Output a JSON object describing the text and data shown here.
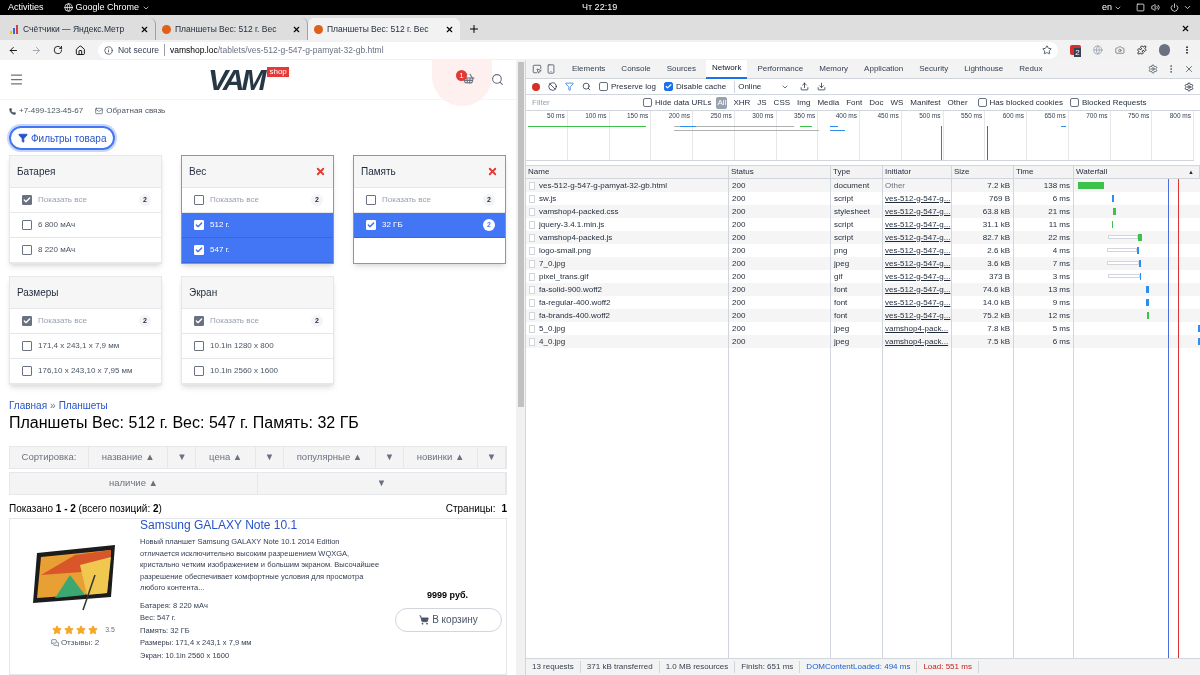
{
  "system_bar": {
    "activities": "Activities",
    "app": "Google Chrome",
    "clock": "Чт 22:19",
    "language": "en"
  },
  "browser": {
    "tabs": [
      {
        "title": "Счётчики — Яндекс.Метр",
        "selected": false,
        "kind": "metrika"
      },
      {
        "title": "Планшеты Вес: 512 г. Вес",
        "selected": false,
        "kind": "site"
      },
      {
        "title": "Планшеты Вес: 512 г. Вес",
        "selected": true,
        "kind": "site"
      }
    ],
    "security": "Not secure",
    "url_host": "vamshop.loc",
    "url_path": "/tablets/ves-512-g-547-g-pamyat-32-gb.html",
    "extension_badge": "2"
  },
  "site": {
    "logo": "VAM",
    "logo_tag": "shop",
    "cart_count": "1",
    "phone": "+7-499-123-45-67",
    "feedback": "Обратная связь",
    "filters_button": "Фильтры товара",
    "filters": [
      {
        "title": "Батарея",
        "active": false,
        "options": [
          {
            "label": "Показать все",
            "count": "2",
            "kind": "all",
            "checked": true,
            "selected": false
          },
          {
            "label": "6 800 мАч",
            "kind": "value",
            "checked": false,
            "selected": false
          },
          {
            "label": "8 220 мАч",
            "kind": "value",
            "checked": false,
            "selected": false
          }
        ]
      },
      {
        "title": "Вес",
        "active": true,
        "options": [
          {
            "label": "Показать все",
            "count": "2",
            "kind": "all",
            "checked": false,
            "selected": false
          },
          {
            "label": "512 г.",
            "kind": "value",
            "checked": true,
            "selected": true
          },
          {
            "label": "547 г.",
            "kind": "value",
            "checked": true,
            "selected": true
          }
        ]
      },
      {
        "title": "Память",
        "active": true,
        "options": [
          {
            "label": "Показать все",
            "count": "2",
            "kind": "all",
            "checked": false,
            "selected": false
          },
          {
            "label": "32 ГБ",
            "count": "2",
            "kind": "value",
            "checked": true,
            "selected": true
          }
        ]
      },
      {
        "title": "Размеры",
        "active": false,
        "options": [
          {
            "label": "Показать все",
            "count": "2",
            "kind": "all",
            "checked": true,
            "selected": false
          },
          {
            "label": "171,4 x 243,1 x 7,9 мм",
            "kind": "value",
            "checked": false,
            "selected": false
          },
          {
            "label": "176,10 x 243,10 x 7,95 мм",
            "kind": "value",
            "checked": false,
            "selected": false
          }
        ]
      },
      {
        "title": "Экран",
        "active": false,
        "options": [
          {
            "label": "Показать все",
            "count": "2",
            "kind": "all",
            "checked": true,
            "selected": false
          },
          {
            "label": "10.1in 1280 x 800",
            "kind": "value",
            "checked": false,
            "selected": false
          },
          {
            "label": "10.1in 2560 x 1600",
            "kind": "value",
            "checked": false,
            "selected": false
          }
        ]
      }
    ],
    "breadcrumbs": [
      "Главная",
      "Планшеты"
    ],
    "breadcrumb_separator": "»",
    "heading": "Планшеты Вес: 512 г. Вес: 547 г. Память: 32 ГБ",
    "sort": {
      "label": "Сортировка:",
      "rows": [
        {
          "options": [
            {
              "asc": "название ▲",
              "desc": "▼"
            },
            {
              "asc": "цена ▲",
              "desc": "▼"
            },
            {
              "asc": "популярные ▲",
              "desc": "▼"
            },
            {
              "asc": "новинки ▲",
              "desc": "▼"
            }
          ]
        },
        {
          "options": [
            {
              "asc": "наличие ▲",
              "desc": "▼"
            }
          ]
        }
      ]
    },
    "shown": "Показано **1 - 2** (всего позиций: **2**)",
    "pages_label": "Страницы:",
    "page": "1",
    "products": [
      {
        "title": "Samsung GALAXY Note 10.1",
        "description": "Новый планшет Samsung GALAXY Note 10.1 2014 Edition отличается исключительно высоким разрешением WQXGA, кристально четким изображением и большим экраном. Высочайшее разрешение обеспечивает комфортные условия для просмотра любого контента...",
        "stars": 4,
        "rating": "3.5",
        "reviews": "Отзывы: 2",
        "price": "9999 руб.",
        "cart_button": "В корзину",
        "specs": [
          "Батарея: 8 220 мАч",
          "Вес: 547 г.",
          "Память: 32 ГБ",
          "Размеры: 171,4 x 243,1 x 7,9 мм",
          "Экран: 10.1in 2560 x 1600"
        ]
      }
    ]
  },
  "devtools": {
    "tabs": [
      {
        "label": "Elements",
        "selected": false
      },
      {
        "label": "Console",
        "selected": false
      },
      {
        "label": "Sources",
        "selected": false
      },
      {
        "label": "Network",
        "selected": true
      },
      {
        "label": "Performance",
        "selected": false
      },
      {
        "label": "Memory",
        "selected": false
      },
      {
        "label": "Application",
        "selected": false
      },
      {
        "label": "Security",
        "selected": false
      },
      {
        "label": "Lighthouse",
        "selected": false
      },
      {
        "label": "Redux",
        "selected": false
      }
    ],
    "preserve_log": {
      "label": "Preserve log",
      "checked": false
    },
    "disable_cache": {
      "label": "Disable cache",
      "checked": true
    },
    "throttling": "Online",
    "filter_placeholder": "Filter",
    "hide_data_urls": {
      "label": "Hide data URLs",
      "checked": false
    },
    "type_filters": [
      {
        "label": "All",
        "selected": true
      },
      {
        "label": "XHR",
        "selected": false
      },
      {
        "label": "JS",
        "selected": false
      },
      {
        "label": "CSS",
        "selected": false
      },
      {
        "label": "Img",
        "selected": false
      },
      {
        "label": "Media",
        "selected": false
      },
      {
        "label": "Font",
        "selected": false
      },
      {
        "label": "Doc",
        "selected": false
      },
      {
        "label": "WS",
        "selected": false
      },
      {
        "label": "Manifest",
        "selected": false
      },
      {
        "label": "Other",
        "selected": false
      }
    ],
    "has_blocked_cookies": {
      "label": "Has blocked cookies",
      "checked": false
    },
    "blocked_requests": {
      "label": "Blocked Requests",
      "checked": false
    },
    "timeline_ticks": [
      "50 ms",
      "100 ms",
      "150 ms",
      "200 ms",
      "250 ms",
      "300 ms",
      "350 ms",
      "400 ms",
      "450 ms",
      "500 ms",
      "550 ms",
      "600 ms",
      "650 ms",
      "700 ms",
      "750 ms",
      "800 ms"
    ],
    "columns": [
      "Name",
      "Status",
      "Type",
      "Initiator",
      "Size",
      "Time",
      "Waterfall"
    ],
    "sort_indicator": "▲",
    "rows": [
      {
        "name": "ves-512-g-547-g-pamyat-32-gb.html",
        "status": "200",
        "type": "document",
        "initiator": "Other",
        "initiator_link": false,
        "size": "7.2 kB",
        "time": "138 ms"
      },
      {
        "name": "sw.js",
        "status": "200",
        "type": "script",
        "initiator": "ves-512-g-547-g...",
        "initiator_link": true,
        "size": "769 B",
        "time": "6 ms"
      },
      {
        "name": "vamshop4-packed.css",
        "status": "200",
        "type": "stylesheet",
        "initiator": "ves-512-g-547-g...",
        "initiator_link": true,
        "size": "63.8 kB",
        "time": "21 ms"
      },
      {
        "name": "jquery-3.4.1.min.js",
        "status": "200",
        "type": "script",
        "initiator": "ves-512-g-547-g...",
        "initiator_link": true,
        "size": "31.1 kB",
        "time": "11 ms"
      },
      {
        "name": "vamshop4-packed.js",
        "status": "200",
        "type": "script",
        "initiator": "ves-512-g-547-g...",
        "initiator_link": true,
        "size": "82.7 kB",
        "time": "22 ms"
      },
      {
        "name": "logo-small.png",
        "status": "200",
        "type": "png",
        "initiator": "ves-512-g-547-g...",
        "initiator_link": true,
        "size": "2.6 kB",
        "time": "4 ms"
      },
      {
        "name": "7_0.jpg",
        "status": "200",
        "type": "jpeg",
        "initiator": "ves-512-g-547-g...",
        "initiator_link": true,
        "size": "3.6 kB",
        "time": "7 ms"
      },
      {
        "name": "pixel_trans.gif",
        "status": "200",
        "type": "gif",
        "initiator": "ves-512-g-547-g...",
        "initiator_link": true,
        "size": "373 B",
        "time": "3 ms"
      },
      {
        "name": "fa-solid-900.woff2",
        "status": "200",
        "type": "font",
        "initiator": "ves-512-g-547-g...",
        "initiator_link": true,
        "size": "74.6 kB",
        "time": "13 ms"
      },
      {
        "name": "fa-regular-400.woff2",
        "status": "200",
        "type": "font",
        "initiator": "ves-512-g-547-g...",
        "initiator_link": true,
        "size": "14.0 kB",
        "time": "9 ms"
      },
      {
        "name": "fa-brands-400.woff2",
        "status": "200",
        "type": "font",
        "initiator": "ves-512-g-547-g...",
        "initiator_link": true,
        "size": "75.2 kB",
        "time": "12 ms"
      },
      {
        "name": "5_0.jpg",
        "status": "200",
        "type": "jpeg",
        "initiator": "vamshop4-pack...",
        "initiator_link": true,
        "size": "7.8 kB",
        "time": "5 ms"
      },
      {
        "name": "4_0.jpg",
        "status": "200",
        "type": "jpeg",
        "initiator": "vamshop4-pack...",
        "initiator_link": true,
        "size": "7.5 kB",
        "time": "6 ms"
      }
    ],
    "status_bar": [
      {
        "text": "13 requests",
        "kind": "plain"
      },
      {
        "text": "371 kB transferred",
        "kind": "plain"
      },
      {
        "text": "1.0 MB resources",
        "kind": "plain"
      },
      {
        "text": "Finish: 651 ms",
        "kind": "plain"
      },
      {
        "text": "DOMContentLoaded: 494 ms",
        "kind": "dcl"
      },
      {
        "text": "Load: 551 ms",
        "kind": "load"
      }
    ]
  }
}
